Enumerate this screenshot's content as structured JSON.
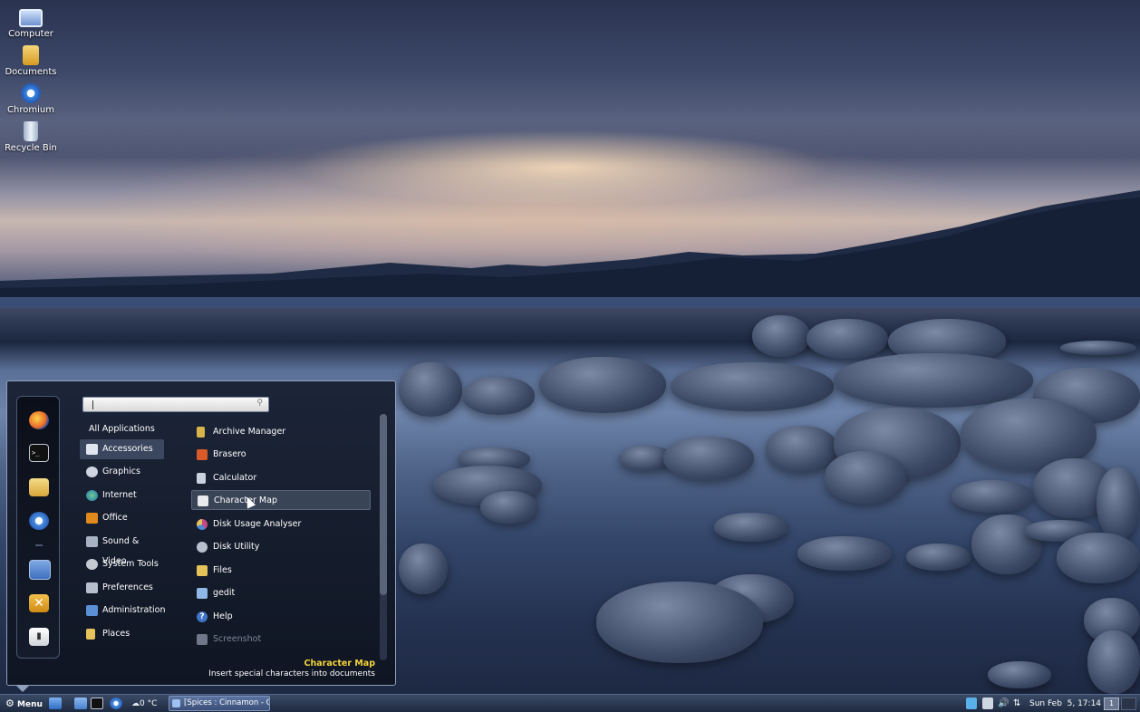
{
  "desktop": {
    "icons": [
      {
        "label": "Computer",
        "icon": "computer-icon",
        "color": "#9fb8e8"
      },
      {
        "label": "Documents",
        "icon": "folder-icon",
        "color": "#e8b540"
      },
      {
        "label": "Chromium",
        "icon": "chromium-icon",
        "color": "#3b86e0"
      },
      {
        "label": "Recycle Bin",
        "icon": "recycle-bin-icon",
        "color": "#c9d6e6"
      }
    ]
  },
  "menu": {
    "search": {
      "value": "",
      "placeholder": ""
    },
    "favorites": [
      {
        "icon": "firefox-icon",
        "color": "#e8692a"
      },
      {
        "icon": "terminal-icon",
        "color": "#1a1a1a"
      },
      {
        "icon": "files-icon",
        "color": "#e6c35a"
      },
      {
        "icon": "chromium-icon",
        "color": "#4a90e2"
      },
      {
        "icon": "lock-screen-icon",
        "color": "#5b8dd6"
      },
      {
        "icon": "logout-icon",
        "color": "#e1a21c"
      },
      {
        "icon": "shutdown-icon",
        "color": "#f0f0f0"
      }
    ],
    "all_applications_label": "All Applications",
    "categories": [
      {
        "label": "Accessories",
        "icon": "accessories-icon",
        "color": "#dfe6ef",
        "selected": true
      },
      {
        "label": "Graphics",
        "icon": "graphics-icon",
        "color": "#cfd6e2"
      },
      {
        "label": "Internet",
        "icon": "internet-icon",
        "color": "#3fa05a"
      },
      {
        "label": "Office",
        "icon": "office-icon",
        "color": "#e08a1e"
      },
      {
        "label": "Sound & Video",
        "icon": "sound-video-icon",
        "color": "#a8b2c2"
      },
      {
        "label": "System Tools",
        "icon": "system-tools-icon",
        "color": "#c5c9d2"
      },
      {
        "label": "Preferences",
        "icon": "preferences-icon",
        "color": "#b8bfcc"
      },
      {
        "label": "Administration",
        "icon": "administration-icon",
        "color": "#5b8fd6"
      },
      {
        "label": "Places",
        "icon": "places-icon",
        "color": "#e6c35a"
      }
    ],
    "apps": [
      {
        "label": "Archive Manager",
        "icon": "archive-manager-icon",
        "color": "#d8b24a"
      },
      {
        "label": "Brasero",
        "icon": "brasero-icon",
        "color": "#d85a2a"
      },
      {
        "label": "Calculator",
        "icon": "calculator-icon",
        "color": "#c9d3df"
      },
      {
        "label": "Character Map",
        "icon": "character-map-icon",
        "color": "#e8eaee",
        "hover": true
      },
      {
        "label": "Disk Usage Analyser",
        "icon": "disk-usage-icon",
        "color": "#c34a86"
      },
      {
        "label": "Disk Utility",
        "icon": "disk-utility-icon",
        "color": "#b9c1cf"
      },
      {
        "label": "Files",
        "icon": "files-icon",
        "color": "#e6c35a"
      },
      {
        "label": "gedit",
        "icon": "gedit-icon",
        "color": "#8fb8e6"
      },
      {
        "label": "Help",
        "icon": "help-icon",
        "color": "#3f74c8"
      },
      {
        "label": "Screenshot",
        "icon": "screenshot-icon",
        "color": "#6f7788",
        "dim": true
      }
    ],
    "description": {
      "title": "Character Map",
      "text": "Insert special characters into documents",
      "title_color": "#f3d33a"
    }
  },
  "panel": {
    "menu_label": "Menu",
    "weather": "0 °C",
    "window_title": "[Spices : Cinnamon - Ch...",
    "clock": "Sun Feb  5, 17:14",
    "workspace": "1"
  }
}
